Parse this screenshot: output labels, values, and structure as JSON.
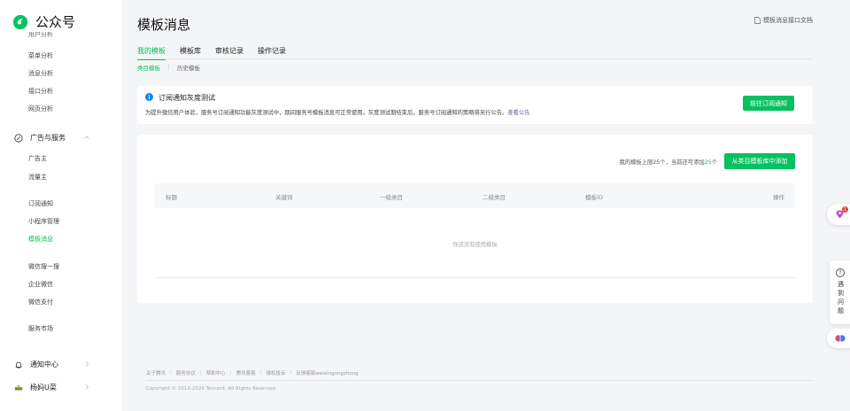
{
  "brand": {
    "name": "公众号",
    "color": "#07c160"
  },
  "sidebar": {
    "cut_item": "用户分析",
    "analysis_items": [
      {
        "label": "菜单分析"
      },
      {
        "label": "消息分析"
      },
      {
        "label": "接口分析"
      },
      {
        "label": "网页分析"
      }
    ],
    "ads_group": {
      "label": "广告与服务",
      "icon": "target-icon"
    },
    "ads_items": [
      {
        "label": "广告主"
      },
      {
        "label": "流量主"
      }
    ],
    "service_items": [
      {
        "label": "订阅通知"
      },
      {
        "label": "小程序管理"
      },
      {
        "label": "模板消息",
        "active": true
      }
    ],
    "other_items": [
      {
        "label": "微信搜一搜"
      },
      {
        "label": "企业微信"
      },
      {
        "label": "微信支付"
      }
    ],
    "market_item": {
      "label": "服务市场"
    },
    "notify_group": {
      "label": "通知中心",
      "icon": "bell-icon"
    },
    "user_group": {
      "label": "杨妈U菜",
      "icon": "avatar"
    }
  },
  "header": {
    "title": "模板消息",
    "doc_link": "模板消息接口文档"
  },
  "tabs": [
    {
      "label": "我的模板",
      "active": true
    },
    {
      "label": "模板库"
    },
    {
      "label": "审核记录"
    },
    {
      "label": "操作记录"
    }
  ],
  "subtabs": [
    {
      "label": "类目模板",
      "active": true
    },
    {
      "label": "历史模板"
    }
  ],
  "notice": {
    "title": "订阅通知灰度测试",
    "desc": "为提升微信用户体验，服务号订阅通知功能灰度测试中，期间服务号模板消息可正常使用。灰度测试期结束后，服务号订阅通知的策略将另行公告。",
    "link": "查看公告",
    "button": "前往订阅通知"
  },
  "quota": {
    "prefix": "我的模板上限25个，当前还可添加",
    "remaining": "25",
    "suffix": "个"
  },
  "add_button": "从类目模板库中添加",
  "table": {
    "columns": [
      "标题",
      "关键词",
      "一级类目",
      "二级类目",
      "模板ID",
      "操作"
    ],
    "empty_text": "你还没有使用模板"
  },
  "footer": {
    "links": [
      "关于腾讯",
      "服务协议",
      "帮助中心",
      "腾讯客服",
      "侵权投诉",
      "反馈客服weixingongzhong"
    ],
    "copyright": "Copyright © 2012-2024 Tencent. All Rights Reserved."
  },
  "float_widgets": {
    "badge_count": "1",
    "help_text": "遇到问题"
  }
}
